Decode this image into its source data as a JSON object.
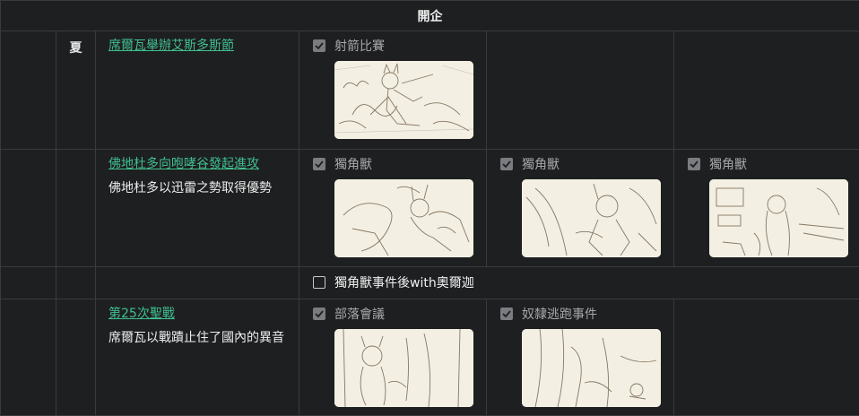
{
  "header": {
    "title": "開企"
  },
  "sections": {
    "season": "夏",
    "row1": {
      "event_link": "席爾瓦舉辦艾斯多斯節",
      "options": [
        {
          "label": "射箭比賽",
          "checked": true,
          "image": "sketch-archery"
        }
      ]
    },
    "row2": {
      "event_link": "佛地杜多向咆哮谷發起進攻",
      "description": "佛地杜多以迅雷之勢取得優勢",
      "options": [
        {
          "label": "獨角獸",
          "checked": true,
          "image": "sketch-unicorn-1"
        },
        {
          "label": "獨角獸",
          "checked": true,
          "image": "sketch-unicorn-2"
        },
        {
          "label": "獨角獸",
          "checked": true,
          "image": "sketch-unicorn-3"
        }
      ]
    },
    "row3": {
      "option": {
        "label": "獨角獸事件後with奧爾迦",
        "checked": false
      }
    },
    "row4": {
      "event_link": "第25次聖戰",
      "description": "席爾瓦以戰蹟止住了國內的異音",
      "options": [
        {
          "label": "部落會議",
          "checked": true,
          "image": "sketch-council"
        },
        {
          "label": "奴隸逃跑事件",
          "checked": true,
          "image": "sketch-escape"
        }
      ]
    }
  },
  "colors": {
    "background": "#1e1f21",
    "border": "#3a3b3e",
    "link": "#3fbf8f",
    "checkbox_checked": "#7a7c80",
    "thumbnail_paper": "#f3efe2",
    "sketch_line": "#6b5a45"
  }
}
